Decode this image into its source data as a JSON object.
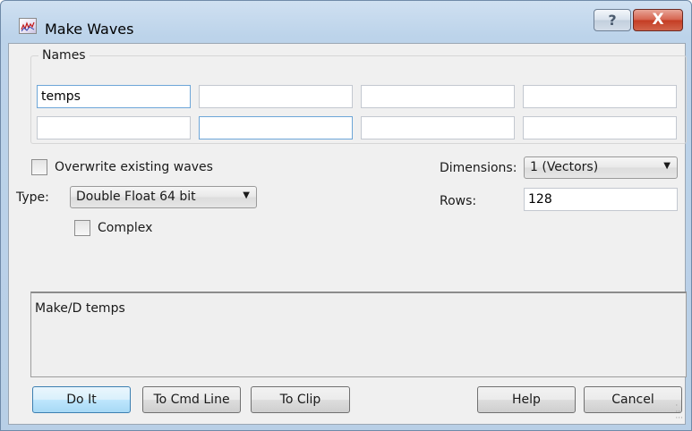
{
  "window": {
    "title": "Make Waves",
    "help_glyph": "?",
    "close_glyph": "X"
  },
  "names": {
    "group_label": "Names",
    "fields": [
      "temps",
      "",
      "",
      "",
      "",
      "",
      "",
      ""
    ]
  },
  "options": {
    "overwrite_label": "Overwrite existing waves",
    "overwrite_checked": false,
    "type_label": "Type:",
    "type_value": "Double Float 64 bit",
    "complex_label": "Complex",
    "complex_checked": false,
    "dimensions_label": "Dimensions:",
    "dimensions_value": "1 (Vectors)",
    "rows_label": "Rows:",
    "rows_value": "128"
  },
  "command": {
    "text": "Make/D temps"
  },
  "buttons": {
    "do_it": "Do It",
    "to_cmd_line": "To Cmd Line",
    "to_clip": "To Clip",
    "help": "Help",
    "cancel": "Cancel"
  },
  "icons": {
    "app": "igor-pro-app-icon",
    "dropdown": "dropdown-arrow-icon",
    "resize": "resize-grip-icon"
  },
  "colors": {
    "title_bar": "#bcd3ea",
    "close_button": "#c43c23",
    "client_bg": "#f0f0f0",
    "default_button": "#bee6fd"
  }
}
